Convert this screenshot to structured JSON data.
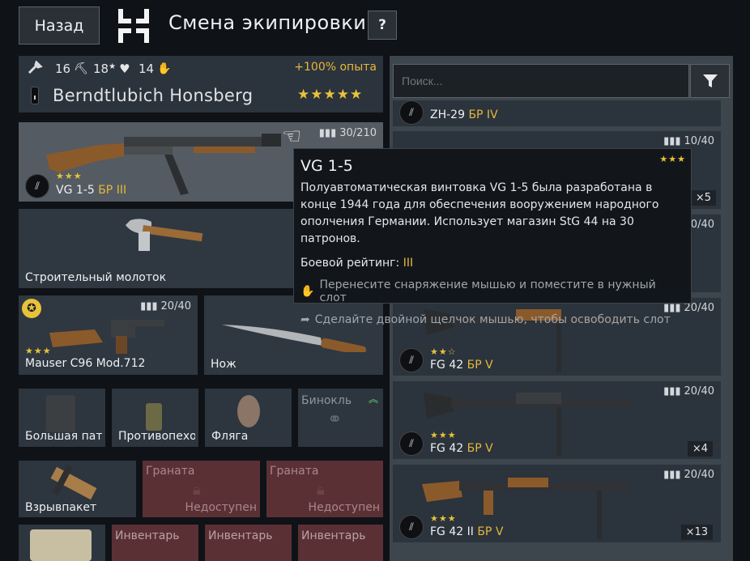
{
  "header": {
    "back_label": "Назад",
    "title": "Смена экипировки",
    "help_label": "?"
  },
  "soldier": {
    "stat_repair": "16",
    "stat_level": "18",
    "stat_health": "14",
    "exp_bonus": "+100% опыта",
    "name": "Berndtlubich Honsberg",
    "stars": "★★★★★"
  },
  "slots": {
    "main_weapon": {
      "name": "VG 1-5",
      "br": "БР III",
      "ammo": "30/210",
      "stars": "★★★"
    },
    "tool": {
      "name": "Строительный молоток"
    },
    "sidearm": {
      "name": "Mauser C96 Mod.712",
      "ammo": "20/40",
      "stars": "★★★"
    },
    "melee": {
      "name": "Нож"
    },
    "pouch": {
      "name": "Большая пат"
    },
    "antitank": {
      "name": "Противопехо"
    },
    "flask": {
      "name": "Фляга"
    },
    "binoculars": {
      "name": "Бинокль"
    },
    "explosive": {
      "name": "Взрывпакет"
    },
    "grenade1": {
      "name": "Граната",
      "status": "Недоступен"
    },
    "grenade2": {
      "name": "Граната",
      "status": "Недоступен"
    },
    "inv1": {
      "name": "Инвентарь"
    },
    "inv2": {
      "name": "Инвентарь"
    },
    "inv3": {
      "name": "Инвентарь"
    }
  },
  "search": {
    "placeholder": "Поиск..."
  },
  "list": [
    {
      "name": "ZH-29",
      "br": "БР IV"
    },
    {
      "ammo": "10/40",
      "stars": "★★★",
      "count": "×5"
    },
    {
      "ammo": "20/40"
    },
    {
      "name": "FG 42",
      "br": "БР V",
      "ammo": "20/40",
      "stars": "★★☆"
    },
    {
      "name": "FG 42",
      "br": "БР V",
      "ammo": "20/40",
      "stars": "★★★",
      "count": "×4"
    },
    {
      "name": "FG 42 II",
      "br": "БР V",
      "ammo": "20/40",
      "stars": "★★★",
      "count": "×13"
    }
  ],
  "tooltip": {
    "title": "VG 1-5",
    "description": "Полуавтоматическая винтовка VG 1-5 была разработана в конце 1944 года для обеспечения вооружением народного ополчения Германии. Использует магазин StG 44 на 30 патронов.",
    "br_label": "Боевой рейтинг:",
    "br_value": "III",
    "hint_drag": "Перенесите снаряжение мышью и поместите в нужный слот",
    "hint_dblclick": "Сделайте двойной щелчок мышью, чтобы освободить слот",
    "stars": "★★★"
  }
}
